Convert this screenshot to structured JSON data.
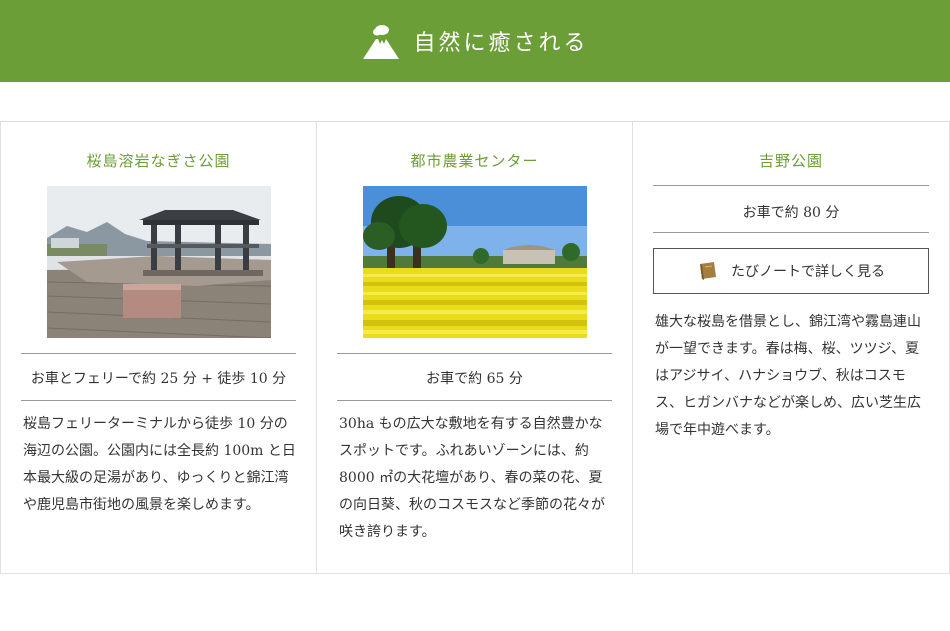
{
  "banner": {
    "title": "自然に癒される",
    "icon": "volcano-icon"
  },
  "colors": {
    "accent": "#6c9e37",
    "border": "#e0e0e0"
  },
  "spots": [
    {
      "name": "桜島溶岩なぎさ公園",
      "access": "お車とフェリーで約 25 分 + 徒歩 10 分",
      "description": "桜島フェリーターミナルから徒歩 10 分の海辺の公園。公園内には全長約 100m と日本最大級の足湯があり、ゆっくりと錦江湾や鹿児島市街地の風景を楽しめます。"
    },
    {
      "name": "都市農業センター",
      "access": "お車で約 65 分",
      "description": "30ha もの広大な敷地を有する自然豊かなスポットです。ふれあいゾーンには、約 8000 ㎡の大花壇があり、春の菜の花、夏の向日葵、秋のコスモスなど季節の花々が咲き誇ります。"
    },
    {
      "name": "吉野公園",
      "access": "お車で約 80 分",
      "note_button": "たびノートで詳しく見る",
      "note_icon": "book-icon",
      "description": "雄大な桜島を借景とし、錦江湾や霧島連山が一望できます。春は梅、桜、ツツジ、夏はアジサイ、ハナショウブ、秋はコスモス、ヒガンバナなどが楽しめ、広い芝生広場で年中遊べます。"
    }
  ]
}
